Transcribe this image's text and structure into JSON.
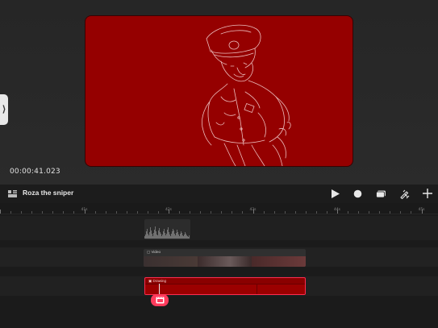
{
  "preview": {
    "timecode": "00:00:41.023",
    "canvas_color": "#950000",
    "line_color": "#f0c8c8"
  },
  "toolbar": {
    "project_title": "Roza the sniper",
    "icons": [
      "clips-icon",
      "play-icon",
      "record-icon",
      "export-icon",
      "draw-icon",
      "add-icon"
    ]
  },
  "ruler": {
    "labels": [
      "41s",
      "42s",
      "43s",
      "44s",
      "45s"
    ]
  },
  "tracks": {
    "video_label": "Video",
    "drawing_label": "Drawing"
  },
  "colors": {
    "accent": "#ff3b5c",
    "clip_red": "#8a0000"
  }
}
